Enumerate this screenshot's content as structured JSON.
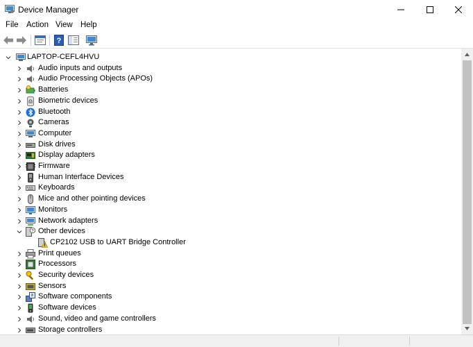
{
  "window": {
    "title": "Device Manager",
    "controls": [
      "minimize",
      "maximize",
      "close"
    ]
  },
  "menu": [
    "File",
    "Action",
    "View",
    "Help"
  ],
  "toolbar": {
    "buttons": [
      "back-arrow-icon",
      "forward-arrow-icon",
      "properties-icon",
      "help-icon",
      "monitor-icon"
    ]
  },
  "tree": {
    "root": "LAPTOP-CEFL4HVU",
    "categories": [
      {
        "label": "Audio inputs and outputs",
        "icon": "speaker-icon",
        "expanded": false
      },
      {
        "label": "Audio Processing Objects (APOs)",
        "icon": "speaker-icon",
        "expanded": false
      },
      {
        "label": "Batteries",
        "icon": "battery-icon",
        "expanded": false
      },
      {
        "label": "Biometric devices",
        "icon": "fingerprint-icon",
        "expanded": false
      },
      {
        "label": "Bluetooth",
        "icon": "bluetooth-icon",
        "expanded": false
      },
      {
        "label": "Cameras",
        "icon": "camera-icon",
        "expanded": false
      },
      {
        "label": "Computer",
        "icon": "computer-icon",
        "expanded": false
      },
      {
        "label": "Disk drives",
        "icon": "disk-drive-icon",
        "expanded": false
      },
      {
        "label": "Display adapters",
        "icon": "display-adapter-icon",
        "expanded": false
      },
      {
        "label": "Firmware",
        "icon": "firmware-icon",
        "expanded": false
      },
      {
        "label": "Human Interface Devices",
        "icon": "hid-icon",
        "expanded": false
      },
      {
        "label": "Keyboards",
        "icon": "keyboard-icon",
        "expanded": false
      },
      {
        "label": "Mice and other pointing devices",
        "icon": "mouse-icon",
        "expanded": false
      },
      {
        "label": "Monitors",
        "icon": "monitor-icon",
        "expanded": false
      },
      {
        "label": "Network adapters",
        "icon": "network-icon",
        "expanded": false
      },
      {
        "label": "Other devices",
        "icon": "unknown-device-icon",
        "expanded": true,
        "children": [
          {
            "label": "CP2102 USB to UART Bridge Controller",
            "icon": "warning-device-icon"
          }
        ]
      },
      {
        "label": "Print queues",
        "icon": "printer-icon",
        "expanded": false
      },
      {
        "label": "Processors",
        "icon": "processor-icon",
        "expanded": false
      },
      {
        "label": "Security devices",
        "icon": "key-icon",
        "expanded": false
      },
      {
        "label": "Sensors",
        "icon": "sensor-icon",
        "expanded": false
      },
      {
        "label": "Software components",
        "icon": "software-component-icon",
        "expanded": false
      },
      {
        "label": "Software devices",
        "icon": "software-device-icon",
        "expanded": false
      },
      {
        "label": "Sound, video and game controllers",
        "icon": "speaker-icon",
        "expanded": false
      },
      {
        "label": "Storage controllers",
        "icon": "storage-icon",
        "expanded": false
      }
    ]
  },
  "colors": {
    "accent": "#1e88e5",
    "warning": "#f4c20d",
    "scroll_thumb": "#c2c2c2",
    "statusbar": "#f0f0f0"
  }
}
